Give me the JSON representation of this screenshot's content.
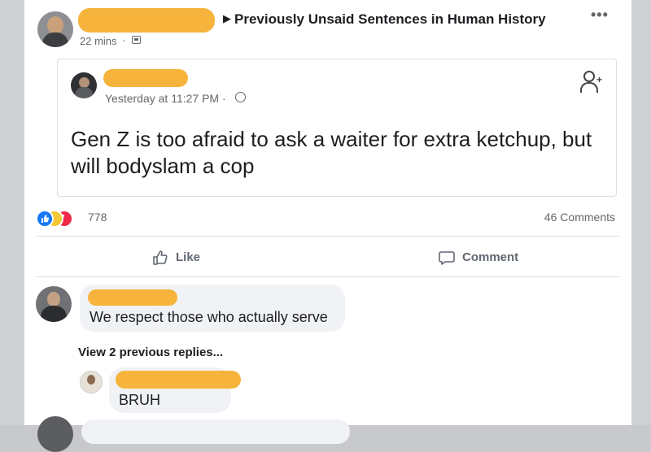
{
  "post": {
    "group_name": "Previously Unsaid Sentences in Human History",
    "time": "22 mins",
    "dot": "·",
    "menu": "•••"
  },
  "shared": {
    "time": "Yesterday at 11:27 PM ·",
    "text": "Gen Z is too afraid to ask a waiter for extra ketchup, but will bodyslam a cop",
    "add_friend_plus": "+"
  },
  "stats": {
    "reaction_count": "778",
    "comment_count": "46 Comments"
  },
  "actions": {
    "like_label": "Like",
    "comment_label": "Comment"
  },
  "comments": [
    {
      "text": "We respect those who actually serve"
    },
    {
      "text": "BRUH"
    }
  ],
  "view_replies": "View 2 previous replies...",
  "colors": {
    "redaction": "#f6b43c",
    "like_blue": "#1877f2",
    "love_red": "#f0284a",
    "haha_yellow": "#f7c736"
  },
  "icons": [
    "author-avatar",
    "group-icon",
    "globe-icon",
    "add-friend-icon",
    "like-thumb-icon",
    "comment-bubble-icon",
    "more-menu-icon"
  ]
}
